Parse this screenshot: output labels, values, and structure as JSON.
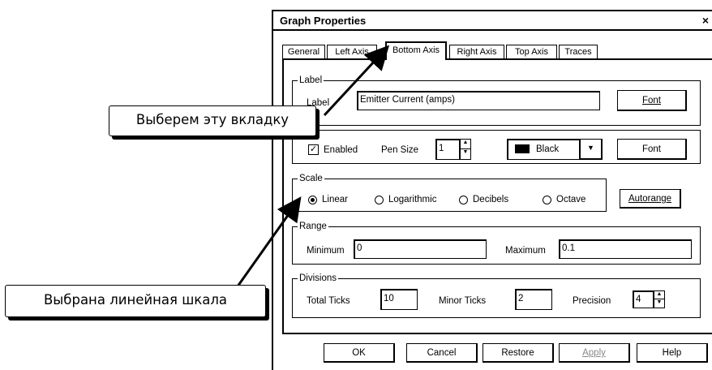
{
  "dialog": {
    "title": "Graph Properties",
    "close_glyph": "×"
  },
  "tabs": [
    {
      "label": "General",
      "active": false
    },
    {
      "label": "Left Axis",
      "active": false
    },
    {
      "label": "Bottom Axis",
      "active": true
    },
    {
      "label": "Right Axis",
      "active": false
    },
    {
      "label": "Top Axis",
      "active": false
    },
    {
      "label": "Traces",
      "active": false
    }
  ],
  "label_group": {
    "legend": "Label",
    "field_label": "Label",
    "value": "Emitter Current (amps)",
    "font_button": "Font"
  },
  "axis_group": {
    "enabled_label": "Enabled",
    "enabled_checked": true,
    "pen_size_label": "Pen Size",
    "pen_size_value": "1",
    "color_value": "Black",
    "color_swatch": "#000000",
    "font_button": "Font"
  },
  "scale_group": {
    "legend": "Scale",
    "options": [
      {
        "label": "Linear",
        "selected": true
      },
      {
        "label": "Logarithmic",
        "selected": false
      },
      {
        "label": "Decibels",
        "selected": false
      },
      {
        "label": "Octave",
        "selected": false
      }
    ],
    "autorange_button": "Autorange"
  },
  "range_group": {
    "legend": "Range",
    "minimum_label": "Minimum",
    "minimum_value": "0",
    "maximum_label": "Maximum",
    "maximum_value": "0.1"
  },
  "divisions_group": {
    "legend": "Divisions",
    "total_ticks_label": "Total Ticks",
    "total_ticks_value": "10",
    "minor_ticks_label": "Minor Ticks",
    "minor_ticks_value": "2",
    "precision_label": "Precision",
    "precision_value": "4"
  },
  "buttons": {
    "ok": "OK",
    "cancel": "Cancel",
    "restore": "Restore",
    "apply": "Apply",
    "help": "Help"
  },
  "callouts": {
    "tab_hint": "Выберем эту вкладку",
    "scale_hint": "Выбрана линейная шкала"
  }
}
